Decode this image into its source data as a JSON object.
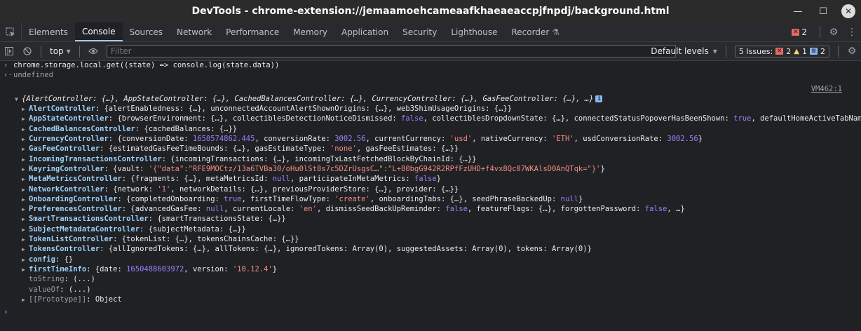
{
  "window": {
    "title": "DevTools - chrome-extension://jemaamoehcameaafkhaeaeaccpjfnpdj/background.html"
  },
  "tabs": [
    "Elements",
    "Console",
    "Sources",
    "Network",
    "Performance",
    "Memory",
    "Application",
    "Security",
    "Lighthouse",
    "Recorder"
  ],
  "error_count": "2",
  "toolbar": {
    "context": "top",
    "filter_placeholder": "Filter",
    "levels": "Default levels",
    "issues_label": "5 Issues:",
    "issues_errors": "2",
    "issues_warnings": "1",
    "issues_info": "2"
  },
  "console": {
    "command": "chrome.storage.local.get((state) => console.log(state.data))",
    "result": "undefined",
    "source": "VM462:1",
    "root_summary": "{AlertController: {…}, AppStateController: {…}, CachedBalancesController: {…}, CurrencyController: {…}, GasFeeController: {…}, …}",
    "rows": [
      {
        "key": "AlertController",
        "segs": [
          [
            "v",
            "{alertEnabledness: {…}, unconnectedAccountAlertShownOrigins: {…}, web3ShimUsageOrigins: {…}}"
          ]
        ]
      },
      {
        "key": "AppStateController",
        "segs": [
          [
            "v",
            "{browserEnvironment: {…}, collectiblesDetectionNoticeDismissed: "
          ],
          [
            "k",
            "false"
          ],
          [
            "v",
            ", collectiblesDropdownState: {…}, connectedStatusPopoverHasBeenShown: "
          ],
          [
            "k",
            "true"
          ],
          [
            "v",
            ", defaultHomeActiveTabName: "
          ],
          [
            "k",
            "null"
          ],
          [
            "v",
            ","
          ]
        ]
      },
      {
        "key": "CachedBalancesController",
        "segs": [
          [
            "v",
            "{cachedBalances: {…}}"
          ]
        ]
      },
      {
        "key": "CurrencyController",
        "segs": [
          [
            "v",
            "{conversionDate: "
          ],
          [
            "n",
            "1650574862.445"
          ],
          [
            "v",
            ", conversionRate: "
          ],
          [
            "n",
            "3002.56"
          ],
          [
            "v",
            ", currentCurrency: "
          ],
          [
            "s",
            "'usd'"
          ],
          [
            "v",
            ", nativeCurrency: "
          ],
          [
            "s",
            "'ETH'"
          ],
          [
            "v",
            ", usdConversionRate: "
          ],
          [
            "n",
            "3002.56"
          ],
          [
            "v",
            "}"
          ]
        ]
      },
      {
        "key": "GasFeeController",
        "segs": [
          [
            "v",
            "{estimatedGasFeeTimeBounds: {…}, gasEstimateType: "
          ],
          [
            "s",
            "'none'"
          ],
          [
            "v",
            ", gasFeeEstimates: {…}}"
          ]
        ]
      },
      {
        "key": "IncomingTransactionsController",
        "segs": [
          [
            "v",
            "{incomingTransactions: {…}, incomingTxLastFetchedBlockByChainId: {…}}"
          ]
        ]
      },
      {
        "key": "KeyringController",
        "segs": [
          [
            "v",
            "{vault: "
          ],
          [
            "s",
            "'{\"data\":\"RFE9MOCtz/13a6TVBa30/oHu0lSt8s7c5DZrUsgsC…\":\"L+80bgG942R2RPfFzUHD+f4vx8Qc07WKAlsD0AnQTqk=\"}'"
          ],
          [
            "v",
            "}"
          ]
        ]
      },
      {
        "key": "MetaMetricsController",
        "segs": [
          [
            "v",
            "{fragments: {…}, metaMetricsId: "
          ],
          [
            "k",
            "null"
          ],
          [
            "v",
            ", participateInMetaMetrics: "
          ],
          [
            "k",
            "false"
          ],
          [
            "v",
            "}"
          ]
        ]
      },
      {
        "key": "NetworkController",
        "segs": [
          [
            "v",
            "{network: "
          ],
          [
            "s",
            "'1'"
          ],
          [
            "v",
            ", networkDetails: {…}, previousProviderStore: {…}, provider: {…}}"
          ]
        ]
      },
      {
        "key": "OnboardingController",
        "segs": [
          [
            "v",
            "{completedOnboarding: "
          ],
          [
            "k",
            "true"
          ],
          [
            "v",
            ", firstTimeFlowType: "
          ],
          [
            "s",
            "'create'"
          ],
          [
            "v",
            ", onboardingTabs: {…}, seedPhraseBackedUp: "
          ],
          [
            "k",
            "null"
          ],
          [
            "v",
            "}"
          ]
        ]
      },
      {
        "key": "PreferencesController",
        "segs": [
          [
            "v",
            "{advancedGasFee: "
          ],
          [
            "k",
            "null"
          ],
          [
            "v",
            ", currentLocale: "
          ],
          [
            "s",
            "'en'"
          ],
          [
            "v",
            ", dismissSeedBackUpReminder: "
          ],
          [
            "k",
            "false"
          ],
          [
            "v",
            ", featureFlags: {…}, forgottenPassword: "
          ],
          [
            "k",
            "false"
          ],
          [
            "v",
            ", …}"
          ]
        ]
      },
      {
        "key": "SmartTransactionsController",
        "segs": [
          [
            "v",
            "{smartTransactionsState: {…}}"
          ]
        ]
      },
      {
        "key": "SubjectMetadataController",
        "segs": [
          [
            "v",
            "{subjectMetadata: {…}}"
          ]
        ]
      },
      {
        "key": "TokenListController",
        "segs": [
          [
            "v",
            "{tokenList: {…}, tokensChainsCache: {…}}"
          ]
        ]
      },
      {
        "key": "TokensController",
        "segs": [
          [
            "v",
            "{allIgnoredTokens: {…}, allTokens: {…}, ignoredTokens: Array(0), suggestedAssets: Array(0), tokens: Array(0)}"
          ]
        ]
      },
      {
        "key": "config",
        "segs": [
          [
            "v",
            "{}"
          ]
        ]
      },
      {
        "key": "firstTimeInfo",
        "segs": [
          [
            "v",
            "{date: "
          ],
          [
            "n",
            "1650488603972"
          ],
          [
            "v",
            ", version: "
          ],
          [
            "s",
            "'10.12.4'"
          ],
          [
            "v",
            "}"
          ]
        ]
      }
    ],
    "extras": [
      {
        "key": "toString",
        "value": "(...)"
      },
      {
        "key": "valueOf",
        "value": "(...)"
      }
    ],
    "prototype": {
      "key": "[[Prototype]]",
      "value": "Object"
    }
  }
}
